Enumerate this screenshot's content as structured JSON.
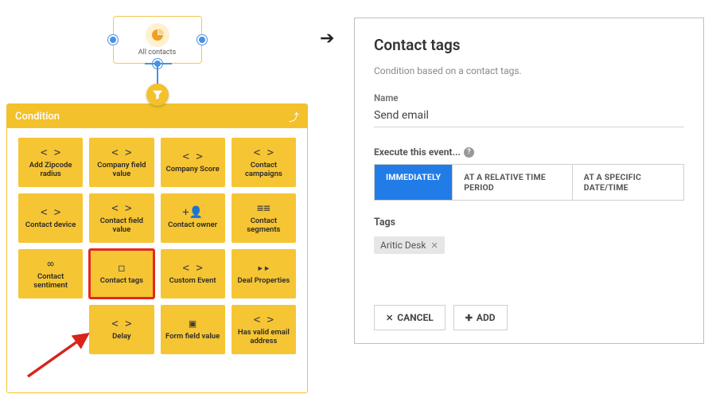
{
  "start_node": {
    "label": "All contacts"
  },
  "arrow_glyph": "➔",
  "condition_panel": {
    "title": "Condition",
    "tiles": [
      {
        "icon": "< >",
        "label": "Add Zipcode radius",
        "hl": false
      },
      {
        "icon": "< >",
        "label": "Company field value",
        "hl": false
      },
      {
        "icon": "< >",
        "label": "Company Score",
        "hl": false
      },
      {
        "icon": "< >",
        "label": "Contact campaigns",
        "hl": false
      },
      {
        "icon": "< >",
        "label": "Contact device",
        "hl": false
      },
      {
        "icon": "< >",
        "label": "Contact field value",
        "hl": false
      },
      {
        "icon": "+👤",
        "label": "Contact owner",
        "hl": false
      },
      {
        "icon": "≡≡",
        "label": "Contact segments",
        "hl": false
      },
      {
        "icon": "∞",
        "label": "Contact sentiment",
        "hl": false
      },
      {
        "icon": "◻",
        "label": "Contact tags",
        "hl": true
      },
      {
        "icon": "< >",
        "label": "Custom Event",
        "hl": false
      },
      {
        "icon": "▸▸",
        "label": "Deal Properties",
        "hl": false
      },
      {
        "icon": "< >",
        "label": "Delay",
        "hl": false,
        "offset": true
      },
      {
        "icon": "▣",
        "label": "Form field value",
        "hl": false
      },
      {
        "icon": "< >",
        "label": "Has valid email address",
        "hl": false
      }
    ]
  },
  "right_panel": {
    "title": "Contact tags",
    "description": "Condition based on a contact tags.",
    "name_label": "Name",
    "name_value": "Send email",
    "execute_label": "Execute this event...",
    "timing_options": [
      {
        "label": "IMMEDIATELY",
        "active": true
      },
      {
        "label": "AT A RELATIVE TIME PERIOD",
        "active": false
      },
      {
        "label": "AT A SPECIFIC DATE/TIME",
        "active": false
      }
    ],
    "tags_label": "Tags",
    "tags": [
      {
        "label": "Aritic Desk"
      }
    ],
    "cancel_label": "CANCEL",
    "add_label": "ADD"
  }
}
